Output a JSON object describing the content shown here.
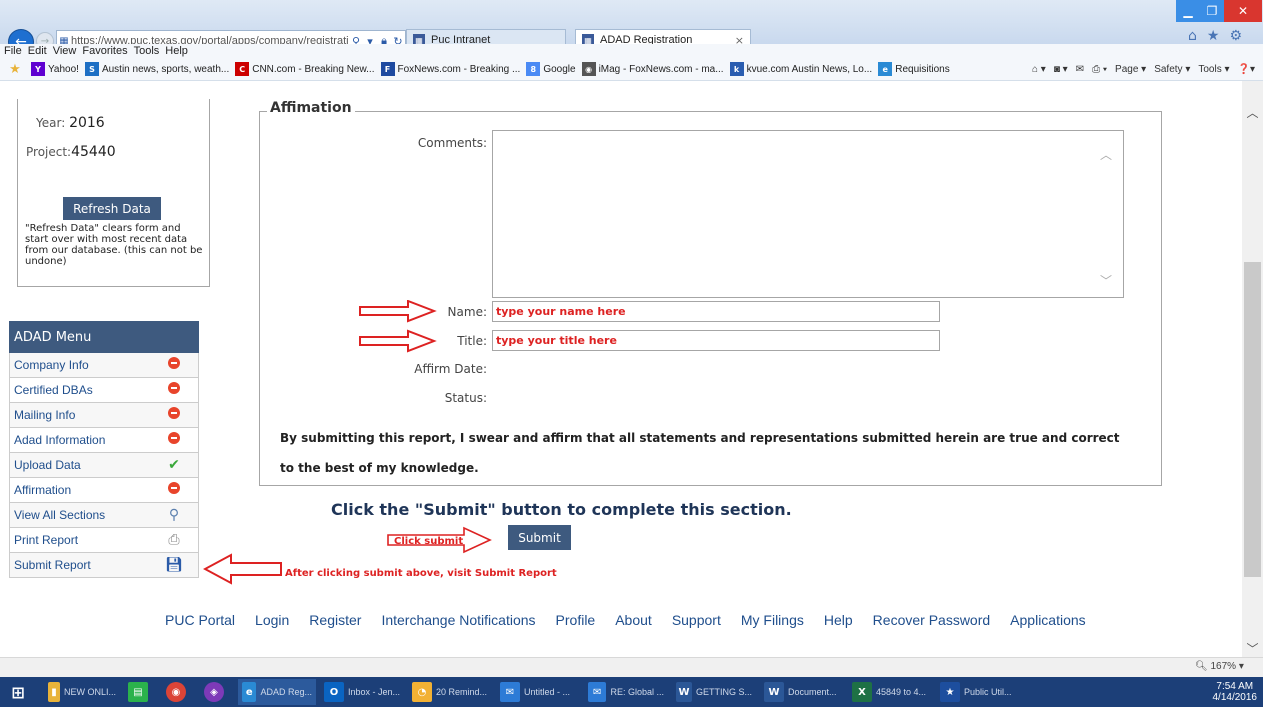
{
  "browser": {
    "url": "https://www.puc.texas.gov/portal/apps/company/registrati",
    "tabs": [
      {
        "label": "Puc Intranet"
      },
      {
        "label": "ADAD Registration"
      }
    ],
    "menu": [
      "File",
      "Edit",
      "View",
      "Favorites",
      "Tools",
      "Help"
    ],
    "favorites": [
      {
        "label": "Yahoo!",
        "icon": "yahoo-icon",
        "color": "#5f01d1"
      },
      {
        "label": "Austin news, sports, weath...",
        "icon": "statesman-icon",
        "color": "#1d6fc4"
      },
      {
        "label": "CNN.com - Breaking New...",
        "icon": "cnn-icon",
        "color": "#cc0000"
      },
      {
        "label": "FoxNews.com - Breaking ...",
        "icon": "fox-icon",
        "color": "#1e4aa0"
      },
      {
        "label": "Google",
        "icon": "google-icon",
        "color": "#4a8af4"
      },
      {
        "label": "iMag - FoxNews.com - ma...",
        "icon": "imag-icon",
        "color": "#555555"
      },
      {
        "label": "kvue.com Austin News, Lo...",
        "icon": "kvue-icon",
        "color": "#2a5db0"
      },
      {
        "label": "Requisitions",
        "icon": "ie-icon",
        "color": "#2a8ad4"
      }
    ],
    "command_bar": [
      "Page ▾",
      "Safety ▾",
      "Tools ▾"
    ],
    "zoom": "167%"
  },
  "info": {
    "year_label": "Year:",
    "year_value": "2016",
    "project_label": "Project:",
    "project_value": "45440",
    "refresh_label": "Refresh Data",
    "refresh_note": "\"Refresh Data\" clears form and start over with most recent data from our database. (this can not be undone)"
  },
  "menu": {
    "title": "ADAD Menu",
    "items": [
      {
        "label": "Company Info",
        "status": "stop"
      },
      {
        "label": "Certified DBAs",
        "status": "stop"
      },
      {
        "label": "Mailing Info",
        "status": "stop"
      },
      {
        "label": "Adad Information",
        "status": "stop"
      },
      {
        "label": "Upload Data",
        "status": "check"
      },
      {
        "label": "Affirmation",
        "status": "stop"
      },
      {
        "label": "View All Sections",
        "status": "search"
      },
      {
        "label": "Print Report",
        "status": "print"
      },
      {
        "label": "Submit Report",
        "status": "save"
      }
    ]
  },
  "form": {
    "legend": "Affimation",
    "comments_label": "Comments:",
    "name_label": "Name:",
    "name_value": "type your name here",
    "title_label": "Title:",
    "title_value": "type your title here",
    "affirm_date_label": "Affirm Date:",
    "status_label": "Status:",
    "declaration": "By submitting this report, I swear and affirm that all statements and representations submitted herein are true and correct to the best of my knowledge.",
    "submit_instruction": "Click the \"Submit\" button to complete this section.",
    "submit_label": "Submit"
  },
  "annotations": {
    "click_submit": "Click submit",
    "after_submit": "After clicking submit above, visit Submit Report"
  },
  "footer": [
    "PUC Portal",
    "Login",
    "Register",
    "Interchange Notifications",
    "Profile",
    "About",
    "Support",
    "My Filings",
    "Help",
    "Recover Password",
    "Applications"
  ],
  "taskbar": {
    "items": [
      {
        "label": "NEW ONLI...",
        "color": "#e8b33a"
      },
      {
        "label": "",
        "color": "#2bb24c"
      },
      {
        "label": "",
        "color": "#db4437"
      },
      {
        "label": "",
        "color": "#7d3ab8"
      },
      {
        "label": "ADAD Reg...",
        "color": "#2a8ad4"
      },
      {
        "label": "Inbox - Jen...",
        "color": "#0a64c2"
      },
      {
        "label": "20 Remind...",
        "color": "#f2b134"
      },
      {
        "label": "Untitled - ...",
        "color": "#2d7bd6"
      },
      {
        "label": "RE: Global ...",
        "color": "#2d7bd6"
      },
      {
        "label": "GETTING S...",
        "color": "#2b5797"
      },
      {
        "label": "Document...",
        "color": "#2b5797"
      },
      {
        "label": "45849 to 4...",
        "color": "#1e7145"
      },
      {
        "label": "Public Util...",
        "color": "#1d4e9e"
      }
    ],
    "time": "7:54 AM",
    "date": "4/14/2016"
  }
}
